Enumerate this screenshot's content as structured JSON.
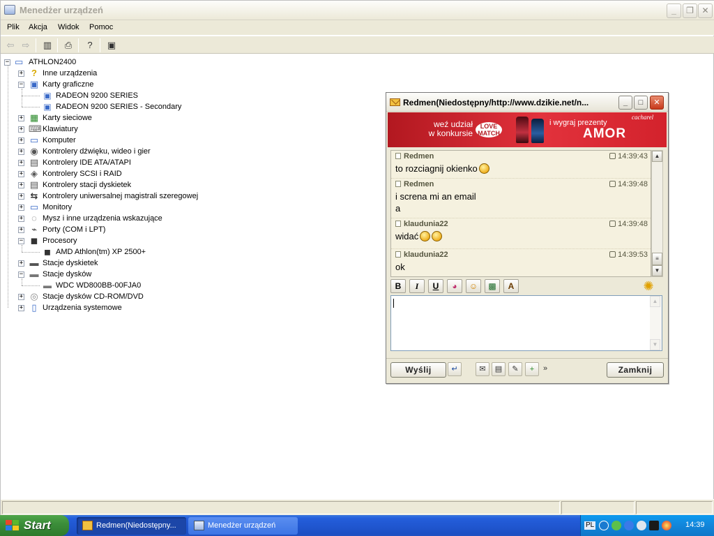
{
  "device_manager": {
    "title": "Menedżer urządzeń",
    "menu": [
      "Plik",
      "Akcja",
      "Widok",
      "Pomoc"
    ],
    "tree": {
      "root": "ATHLON2400",
      "items": [
        {
          "label": "Inne urządzenia",
          "icon": "question-icon",
          "expanded": false
        },
        {
          "label": "Karty graficzne",
          "icon": "display-adapter-icon",
          "expanded": true,
          "children": [
            "RADEON 9200 SERIES",
            "RADEON 9200 SERIES - Secondary"
          ]
        },
        {
          "label": "Karty sieciowe",
          "icon": "network-card-icon",
          "expanded": false
        },
        {
          "label": "Klawiatury",
          "icon": "keyboard-icon",
          "expanded": false
        },
        {
          "label": "Komputer",
          "icon": "computer-icon",
          "expanded": false
        },
        {
          "label": "Kontrolery dźwięku, wideo i gier",
          "icon": "sound-icon",
          "expanded": false
        },
        {
          "label": "Kontrolery IDE ATA/ATAPI",
          "icon": "ide-controller-icon",
          "expanded": false
        },
        {
          "label": "Kontrolery SCSI i RAID",
          "icon": "scsi-icon",
          "expanded": false
        },
        {
          "label": "Kontrolery stacji dyskietek",
          "icon": "floppy-controller-icon",
          "expanded": false
        },
        {
          "label": "Kontrolery uniwersalnej magistrali szeregowej",
          "icon": "usb-icon",
          "expanded": false
        },
        {
          "label": "Monitory",
          "icon": "monitor-icon",
          "expanded": false
        },
        {
          "label": "Mysz i inne urządzenia wskazujące",
          "icon": "mouse-icon",
          "expanded": false
        },
        {
          "label": "Porty (COM i LPT)",
          "icon": "port-icon",
          "expanded": false
        },
        {
          "label": "Procesory",
          "icon": "cpu-icon",
          "expanded": true,
          "children": [
            "AMD Athlon(tm) XP 2500+"
          ]
        },
        {
          "label": "Stacje dyskietek",
          "icon": "floppy-drive-icon",
          "expanded": false
        },
        {
          "label": "Stacje dysków",
          "icon": "disk-drive-icon",
          "expanded": true,
          "children": [
            "WDC WD800BB-00FJA0"
          ]
        },
        {
          "label": "Stacje dysków CD-ROM/DVD",
          "icon": "cdrom-icon",
          "expanded": false
        },
        {
          "label": "Urządzenia systemowe",
          "icon": "system-devices-icon",
          "expanded": false
        }
      ]
    }
  },
  "chat": {
    "title": "Redmen(Niedostępny/http://www.dzikie.net/n...",
    "banner": {
      "line1": "weź udział",
      "line2": "w konkursie",
      "badge1": "LOVE",
      "badge2": "MATCH",
      "line3": "i wygraj prezenty",
      "product": "AMOR",
      "brand": "cacharel"
    },
    "messages": [
      {
        "from": "Redmen",
        "time": "14:39:43",
        "lines": [
          "to rozciagnij okienko"
        ],
        "emoticons": 1
      },
      {
        "from": "Redmen",
        "time": "14:39:48",
        "lines": [
          "i screna mi an email",
          "a"
        ],
        "emoticons": 0
      },
      {
        "from": "klaudunia22",
        "time": "14:39:48",
        "lines": [
          "widać"
        ],
        "emoticons": 2
      },
      {
        "from": "klaudunia22",
        "time": "14:39:53",
        "lines": [
          "ok"
        ],
        "emoticons": 0
      }
    ],
    "format_buttons": [
      "B",
      "I",
      "U"
    ],
    "send_label": "Wyślij",
    "close_label": "Zamknij",
    "input_value": ""
  },
  "taskbar": {
    "start_label": "Start",
    "tasks": [
      {
        "label": "Redmen(Niedostępny...",
        "active": true
      },
      {
        "label": "Menedżer urządzeń",
        "active": false
      }
    ],
    "lang": "PL",
    "clock": "14:39"
  },
  "colors": {
    "xp_blue": "#245edb",
    "start_green": "#3c8e3a",
    "banner_red": "#d3222c"
  }
}
